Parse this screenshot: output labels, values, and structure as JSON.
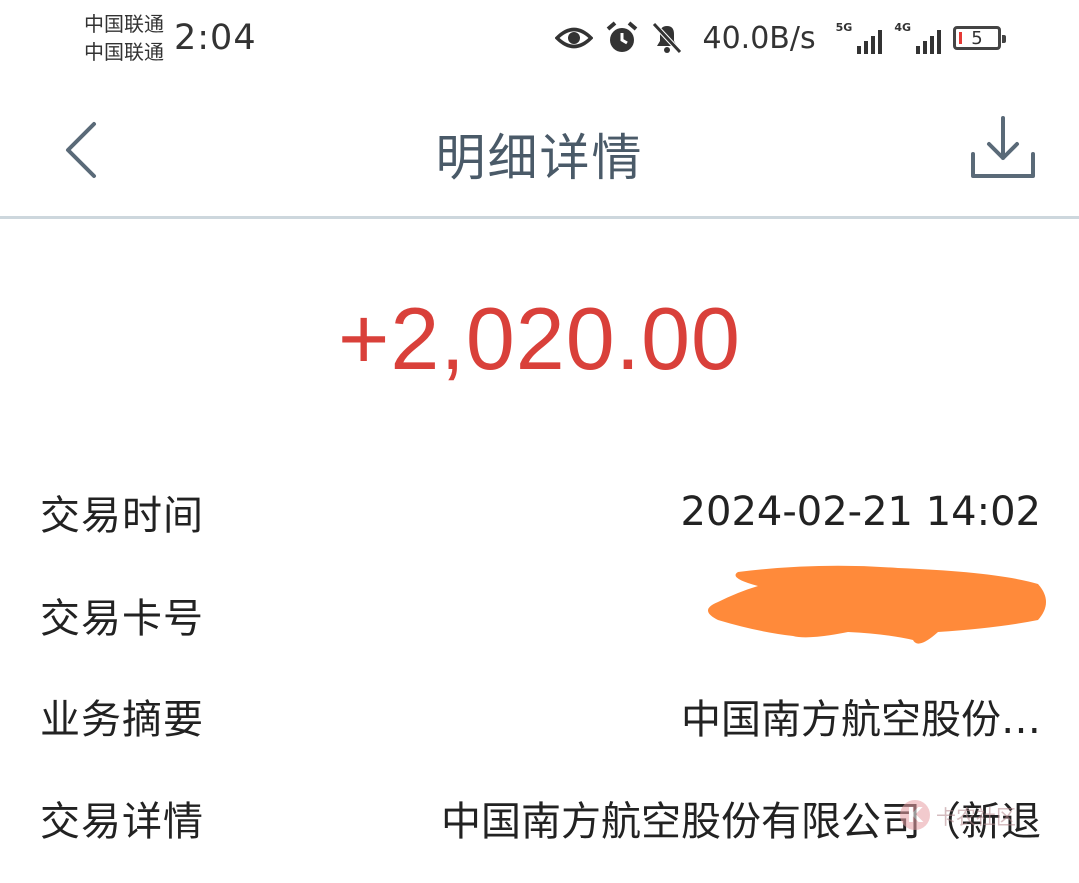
{
  "status_bar": {
    "carrier_1": "中国联通",
    "carrier_2": "中国联通",
    "time": "2:04",
    "net_speed": "40.0B/s",
    "signal_1_tag": "5G",
    "signal_2_tag": "4G",
    "battery_level": "5",
    "icons": [
      "eye-icon",
      "alarm-icon",
      "bell-off-icon"
    ]
  },
  "nav": {
    "title": "明细详情",
    "back_icon": "chevron-left-icon",
    "download_icon": "download-icon"
  },
  "amount": "+2,020.00",
  "colors": {
    "amount": "#d9403a",
    "title": "#4a5a68",
    "redaction": "#ff8a3a"
  },
  "details": [
    {
      "label": "交易时间",
      "value": "2024-02-21 14:02"
    },
    {
      "label": "交易卡号",
      "value": ""
    },
    {
      "label": "业务摘要",
      "value": "中国南方航空股份…"
    },
    {
      "label": "交易详情",
      "value": "中国南方航空股份有限公司（新退"
    }
  ],
  "watermark": {
    "text": "卡农社区"
  }
}
